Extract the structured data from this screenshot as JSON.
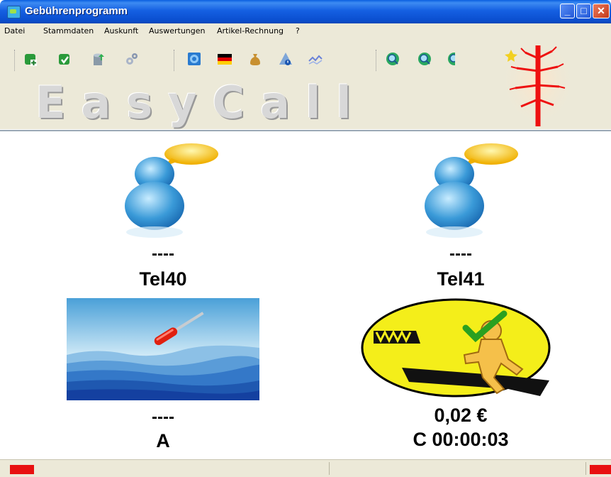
{
  "window": {
    "title": "Gebührenprogramm"
  },
  "menu": [
    {
      "label": "Datei"
    },
    {
      "label": "Stammdaten"
    },
    {
      "label": "Auskunft"
    },
    {
      "label": "Auswertungen"
    },
    {
      "label": "Artikel-Rechnung"
    },
    {
      "label": "?"
    }
  ],
  "logo": {
    "text": "EasyCall"
  },
  "toolbar": {
    "icons": [
      "add-user-icon",
      "user-check-icon",
      "database-export-icon",
      "gears-icon",
      "info-globe-icon",
      "german-flag-icon",
      "money-bag-icon",
      "alert-icon",
      "chart-line-icon",
      "search-icon",
      "search-zoom-icon",
      "search-partial-icon"
    ]
  },
  "phones": [
    {
      "status": "----",
      "name": "Tel40",
      "line1": "----",
      "line2": "A"
    },
    {
      "status": "----",
      "name": "Tel41",
      "line1": "0,02 €",
      "line2": "C 00:00:03"
    }
  ],
  "colors": {
    "titlebar": "#0b55d8",
    "chrome": "#ece9d8",
    "status_indicator": "#e81010"
  }
}
